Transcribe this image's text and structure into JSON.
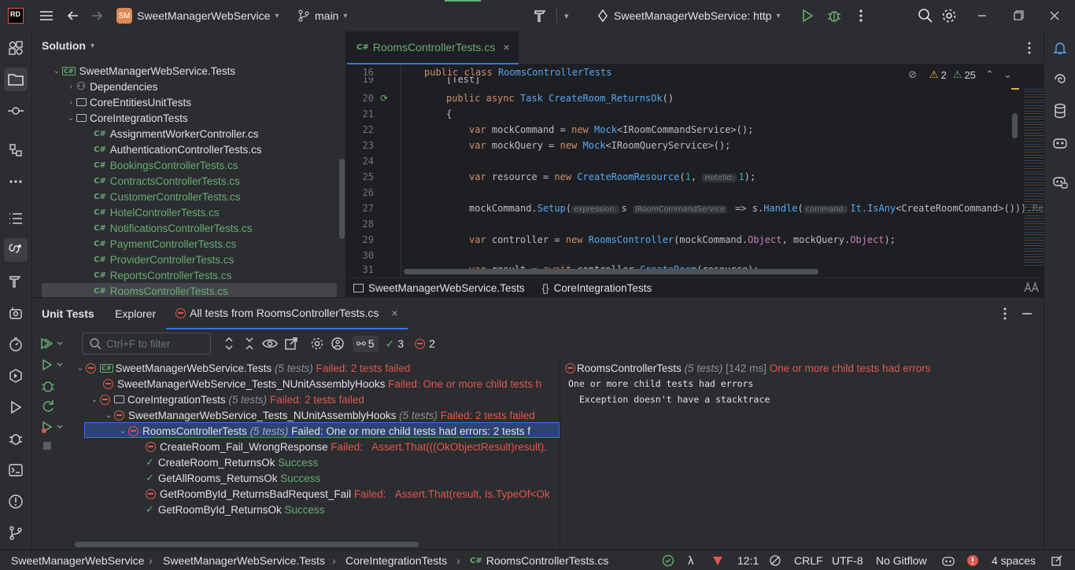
{
  "titlebar": {
    "logo": "RD",
    "project_badge": "SM",
    "project_name": "SweetManagerWebService",
    "branch": "main",
    "run_config": "SweetManagerWebService: http"
  },
  "solution": {
    "header": "Solution",
    "items": [
      {
        "label": "SweetManagerWebService.Tests",
        "kind": "project"
      },
      {
        "label": "Dependencies",
        "kind": "deps"
      },
      {
        "label": "CoreEntitiesUnitTests",
        "kind": "folder"
      },
      {
        "label": "CoreIntegrationTests",
        "kind": "folder"
      },
      {
        "label": "AssignmentWorkerController.cs",
        "kind": "file-plain"
      },
      {
        "label": "AuthenticationControllerTests.cs",
        "kind": "file-plain"
      },
      {
        "label": "BookingsControllerTests.cs",
        "kind": "file"
      },
      {
        "label": "ContractsControllerTests.cs",
        "kind": "file"
      },
      {
        "label": "CustomerControllerTests.cs",
        "kind": "file"
      },
      {
        "label": "HotelControllerTests.cs",
        "kind": "file"
      },
      {
        "label": "NotificationsControllerTests.cs",
        "kind": "file"
      },
      {
        "label": "PaymentControllerTests.cs",
        "kind": "file"
      },
      {
        "label": "ProviderControllerTests.cs",
        "kind": "file"
      },
      {
        "label": "ReportsControllerTests.cs",
        "kind": "file"
      },
      {
        "label": "RoomsControllerTests.cs",
        "kind": "file"
      }
    ],
    "cs_badge": "C#"
  },
  "editor": {
    "tab_label": "RoomsControllerTests.cs",
    "warnings": "2",
    "weak_warnings": "25",
    "lines": {
      "l16": "16",
      "l19": "19",
      "l20": "20",
      "l21": "21",
      "l22": "22",
      "l23": "23",
      "l24": "24",
      "l25": "25",
      "l26": "26",
      "l27": "27",
      "l28": "28",
      "l29": "29",
      "l30": "30",
      "l31": "31"
    },
    "code": {
      "public": "public",
      "class": "class",
      "class_name": "RoomsControllerTests",
      "attr": "[Test]",
      "async": "async",
      "task": "Task",
      "method": "CreateRoom_ReturnsOk",
      "parens": "()",
      "brace": "{",
      "var": "var",
      "new": "new",
      "mock": "Mock",
      "mockCommand": "mockCommand",
      "mockQuery": "mockQuery",
      "icmd": "<IRoomCommandService>();",
      "iqry": "<IRoomQueryService>();",
      "resource": "resource",
      "create_res": "CreateRoomResource",
      "one": "1",
      "hint_hotel": "HotelId:",
      "end1": ");",
      "setup": "Setup",
      "hint_expr": "expression:",
      "s_var": "s",
      "hint_type": "IRoomCommandService",
      "arrow": "=>",
      "handle": "Handle",
      "hint_cmd": "command:",
      "isany": "It.IsAny",
      "create_cmd": "<CreateRoomCommand>())).Re",
      "controller": "controller",
      "rooms_ctrl": "RoomsController",
      "object1": "Object",
      "object2": "Object",
      "result": "result",
      "await": "await",
      "create_room": "CreateRoom",
      "resource_call": "(resource);"
    },
    "breadcrumb_project": "SweetManagerWebService.Tests",
    "breadcrumb_ns": "CoreIntegrationTests",
    "ns_icon": "{}"
  },
  "unit_tests": {
    "tabs": [
      "Unit Tests",
      "Explorer",
      "All tests from RoomsControllerTests.cs"
    ],
    "filter_placeholder": "Ctrl+F to filter",
    "count_total": "5",
    "count_passed": "2",
    "count_passed_label": "3",
    "count_failed": "2",
    "tree": [
      {
        "name": "SweetManagerWebService.Tests",
        "count": "(5 tests)",
        "status": "Failed: 2 tests failed"
      },
      {
        "name": "SweetManagerWebService_Tests_NUnitAssemblyHooks",
        "count": "",
        "status": "Failed: One or more child tests h"
      },
      {
        "name": "CoreIntegrationTests",
        "count": "(5 tests)",
        "status": "Failed: 2 tests failed"
      },
      {
        "name": "SweetManagerWebService_Tests_NUnitAssemblyHooks",
        "count": "(5 tests)",
        "status": "Failed: 2 tests failed"
      },
      {
        "name": "RoomsControllerTests",
        "count": "(5 tests)",
        "status": "Failed: One or more child tests had errors: 2 tests f"
      },
      {
        "name": "CreateRoom_Fail_WrongResponse",
        "count": "",
        "status": "Failed:",
        "detail": "Assert.That(((OkObjectResult)result)."
      },
      {
        "name": "CreateRoom_ReturnsOk",
        "count": "",
        "status": "Success"
      },
      {
        "name": "GetAllRooms_ReturnsOk",
        "count": "",
        "status": "Success"
      },
      {
        "name": "GetRoomById_ReturnsBadRequest_Fail",
        "count": "",
        "status": "Failed:",
        "detail": "Assert.That(result, Is.TypeOf<Ok"
      },
      {
        "name": "GetRoomById_ReturnsOk",
        "count": "",
        "status": "Success"
      }
    ],
    "details": {
      "name": "RoomsControllerTests",
      "count": "(5 tests)",
      "time": "[142 ms]",
      "status": "One or more child tests had errors",
      "line1": "One or more child tests had errors",
      "line2": "Exception doesn't have a stacktrace"
    }
  },
  "statusbar": {
    "crumbs": [
      "SweetManagerWebService",
      "SweetManagerWebService.Tests",
      "CoreIntegrationTests",
      "RoomsControllerTests.cs"
    ],
    "position": "12:1",
    "line_ending": "CRLF",
    "encoding": "UTF-8",
    "gitflow": "No Gitflow",
    "indent": "4 spaces"
  },
  "colors": {
    "accent": "#3574f0",
    "success": "#6aab73",
    "error": "#e0574f",
    "selection": "#2e436e"
  }
}
